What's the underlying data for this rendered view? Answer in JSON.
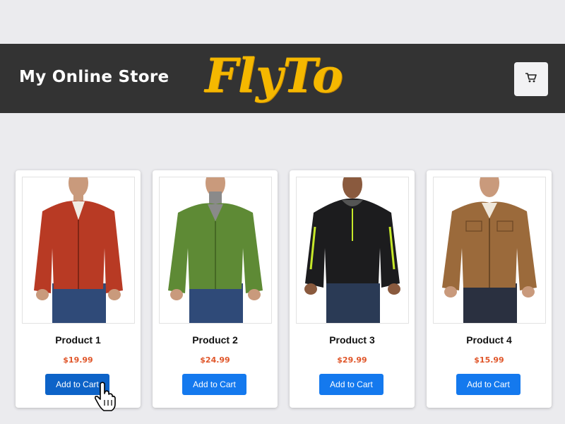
{
  "header": {
    "store_name": "My Online Store",
    "logo_text": "FlyTo",
    "logo_color": "#f5b800",
    "cart_icon": "shopping-cart-icon"
  },
  "products": [
    {
      "name": "Product 1",
      "price": "$19.99",
      "button_label": "Add to Cart",
      "jacket_color": "#b83a24"
    },
    {
      "name": "Product 2",
      "price": "$24.99",
      "button_label": "Add to Cart",
      "jacket_color": "#5e8a35"
    },
    {
      "name": "Product 3",
      "price": "$29.99",
      "button_label": "Add to Cart",
      "jacket_color": "#1c1c1e"
    },
    {
      "name": "Product 4",
      "price": "$15.99",
      "button_label": "Add to Cart",
      "jacket_color": "#9b6a3b"
    }
  ],
  "colors": {
    "header_bg": "#333333",
    "button": "#1479ee",
    "price": "#e0562a"
  }
}
